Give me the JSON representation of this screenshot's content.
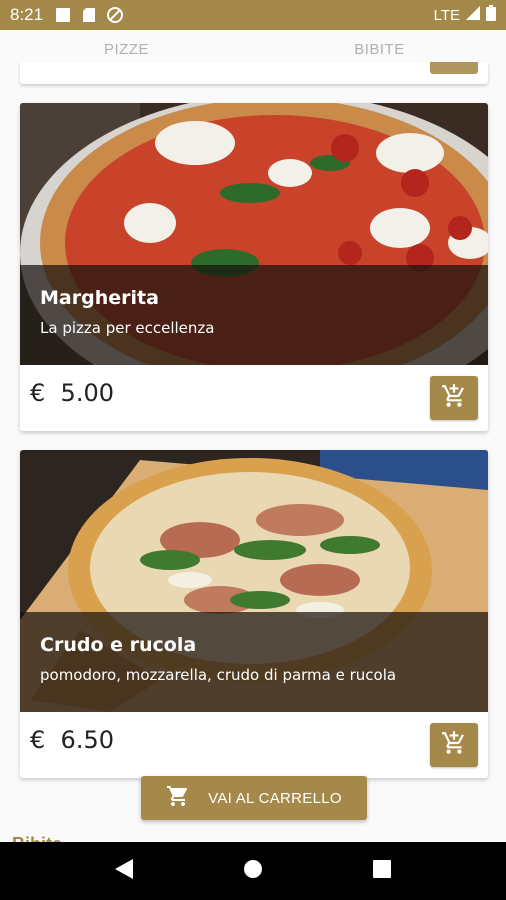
{
  "status_bar": {
    "time": "8:21",
    "network": "LTE",
    "icons": [
      "notification-square-icon",
      "sd-card-icon",
      "no-disturb-icon",
      "signal-icon",
      "battery-icon"
    ]
  },
  "tabs": [
    {
      "label": "PIZZE"
    },
    {
      "label": "BIBITE"
    }
  ],
  "products": [
    {
      "name": "Margherita",
      "description": "La pizza per eccellenza",
      "currency": "€",
      "price": "5.00"
    },
    {
      "name": "Crudo e rucola",
      "description": "pomodoro, mozzarella, crudo di parma e rucola",
      "currency": "€",
      "price": "6.50"
    }
  ],
  "go_to_cart": {
    "label": "VAI AL CARRELLO"
  },
  "next_section": {
    "heading": "Bibite"
  },
  "colors": {
    "accent": "#a4894b",
    "navbar": "#000000"
  }
}
